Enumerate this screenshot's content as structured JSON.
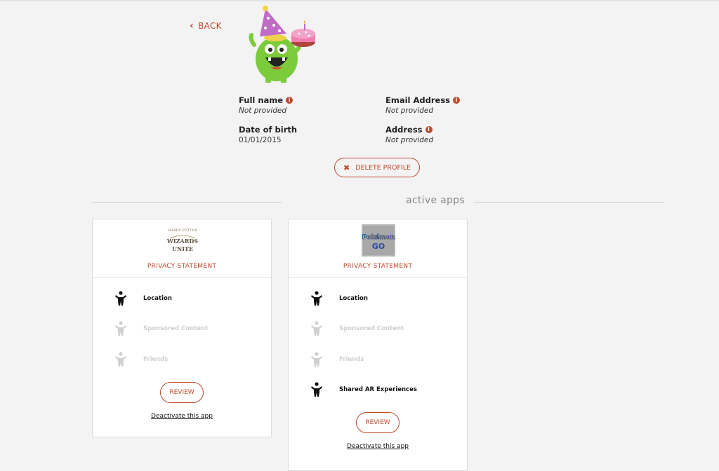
{
  "nav": {
    "back_label": "BACK"
  },
  "profile": {
    "full_name": {
      "label": "Full name",
      "value": "Not provided"
    },
    "email": {
      "label": "Email Address",
      "value": "Not provided"
    },
    "dob": {
      "label": "Date of birth",
      "value": "01/01/2015"
    },
    "address": {
      "label": "Address",
      "value": "Not provided"
    },
    "info_glyph": "i",
    "delete_label": "DELETE PROFILE"
  },
  "section": {
    "title": "active apps"
  },
  "apps": [
    {
      "logo_text": [
        "HARRY POTTER",
        "WIZARDS",
        "UNITE"
      ],
      "privacy_label": "PRIVACY STATEMENT",
      "permissions": [
        {
          "label": "Location",
          "enabled": true
        },
        {
          "label": "Sponsored Content",
          "enabled": false
        },
        {
          "label": "Friends",
          "enabled": false
        }
      ],
      "review_label": "REVIEW",
      "deactivate_label": "Deactivate this app"
    },
    {
      "logo_text": [
        "Pokémon",
        "GO"
      ],
      "privacy_label": "PRIVACY STATEMENT",
      "permissions": [
        {
          "label": "Location",
          "enabled": true
        },
        {
          "label": "Sponsored Content",
          "enabled": false
        },
        {
          "label": "Friends",
          "enabled": false
        },
        {
          "label": "Shared AR Experiences",
          "enabled": true
        }
      ],
      "review_label": "REVIEW",
      "deactivate_label": "Deactivate this app"
    }
  ],
  "colors": {
    "accent": "#c0492c",
    "background": "#f3f3f3",
    "card": "#ffffff",
    "disabled": "#cfcfcf"
  }
}
